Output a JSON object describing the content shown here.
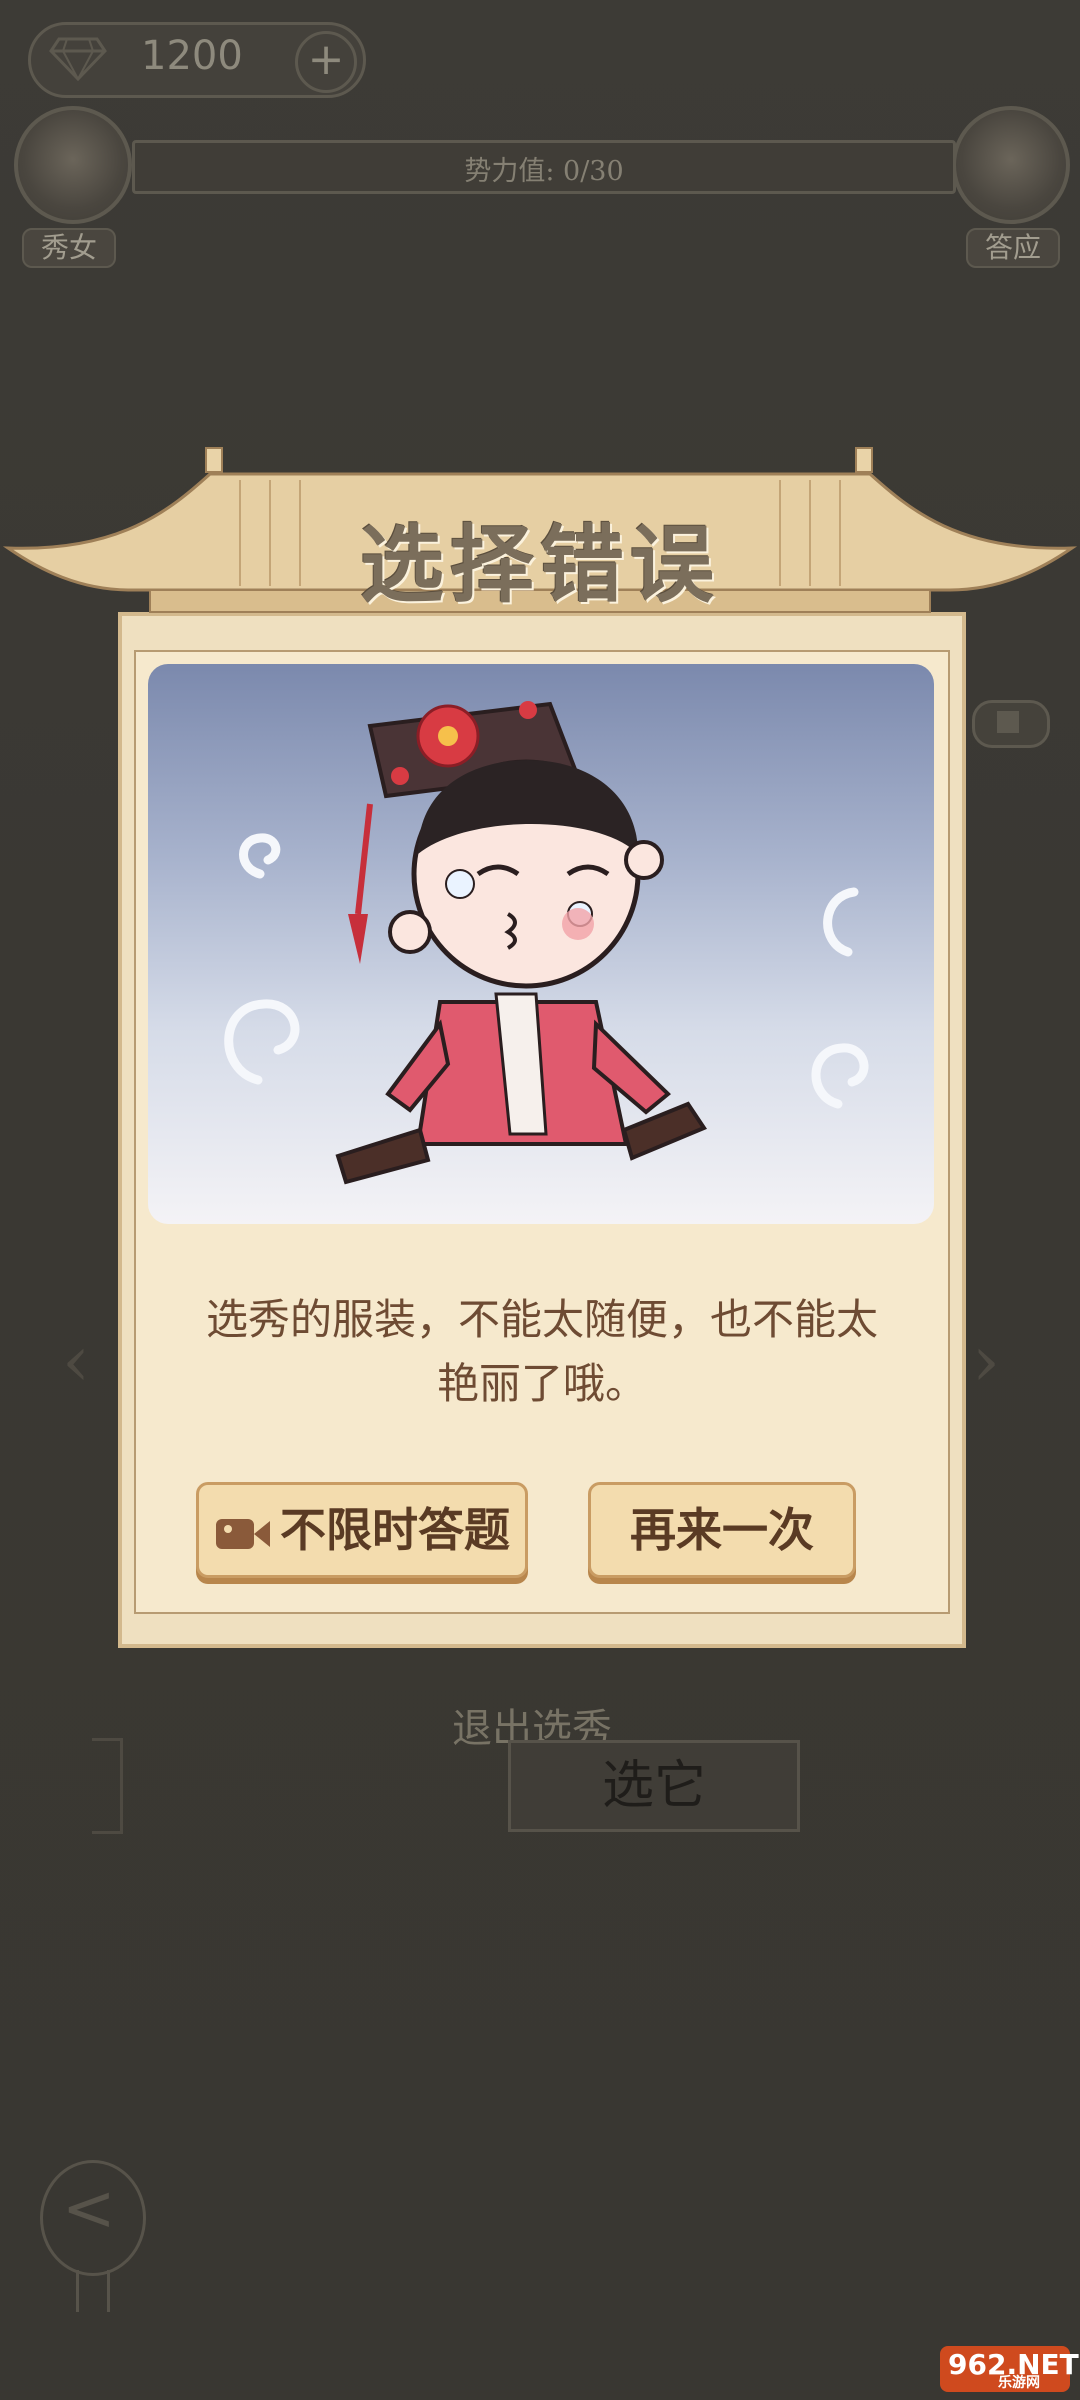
{
  "hud": {
    "gem_icon": "diamond-icon",
    "gem_count": "1200",
    "plus_icon": "plus-icon",
    "power_label": "势力值: 0/30"
  },
  "ranks": {
    "current": "秀女",
    "next": "答应"
  },
  "background": {
    "exit_label": "退出选秀",
    "choose_label": "选它",
    "back_icon": "back-arrow-icon",
    "video_icon": "video-icon"
  },
  "modal": {
    "title": "选择错误",
    "message_line1": "选秀的服装，不能太随便，也不能太",
    "message_line2": "艳丽了哦。",
    "btn_video_icon": "video-camera-icon",
    "btn_video_label": "不限时答题",
    "btn_retry_label": "再来一次"
  },
  "watermark": {
    "top": "962.NET",
    "bottom": "乐游网"
  },
  "colors": {
    "overlay_bg": "#3a3833",
    "modal_paper": "#efe0c0",
    "button_fill": "#f3dcae",
    "text_brown": "#6e4b33"
  }
}
